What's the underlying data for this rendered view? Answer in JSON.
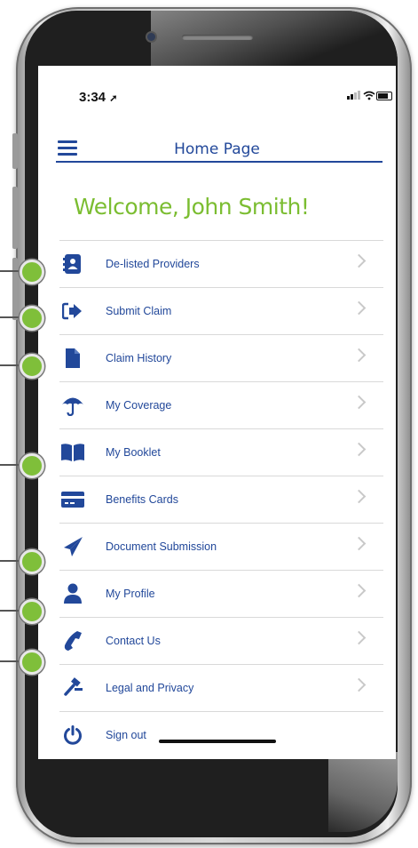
{
  "status_bar": {
    "time": "3:34",
    "location_arrow": "location-arrow-icon"
  },
  "header": {
    "title": "Home Page",
    "menu_icon": "hamburger-menu-icon"
  },
  "welcome_text": "Welcome, John Smith!",
  "menu": {
    "items": [
      {
        "label": "De-listed Providers",
        "icon": "contact-book-icon",
        "has_chevron": true
      },
      {
        "label": "Submit Claim",
        "icon": "sign-in-arrow-icon",
        "has_chevron": true
      },
      {
        "label": "Claim History",
        "icon": "document-icon",
        "has_chevron": true
      },
      {
        "label": "My Coverage",
        "icon": "umbrella-icon",
        "has_chevron": true
      },
      {
        "label": "My Booklet",
        "icon": "open-book-icon",
        "has_chevron": true
      },
      {
        "label": "Benefits Cards",
        "icon": "credit-card-icon",
        "has_chevron": true
      },
      {
        "label": "Document Submission",
        "icon": "paper-plane-icon",
        "has_chevron": true
      },
      {
        "label": "My Profile",
        "icon": "user-icon",
        "has_chevron": true
      },
      {
        "label": "Contact Us",
        "icon": "phone-icon",
        "has_chevron": true
      },
      {
        "label": "Legal and Privacy",
        "icon": "gavel-icon",
        "has_chevron": true
      },
      {
        "label": "Sign out",
        "icon": "power-icon",
        "has_chevron": false
      }
    ]
  },
  "colors": {
    "brand_blue": "#22489a",
    "accent_green": "#7bbd31",
    "callout_green": "#7fbf3a",
    "chevron_gray": "#c9c9c9"
  }
}
